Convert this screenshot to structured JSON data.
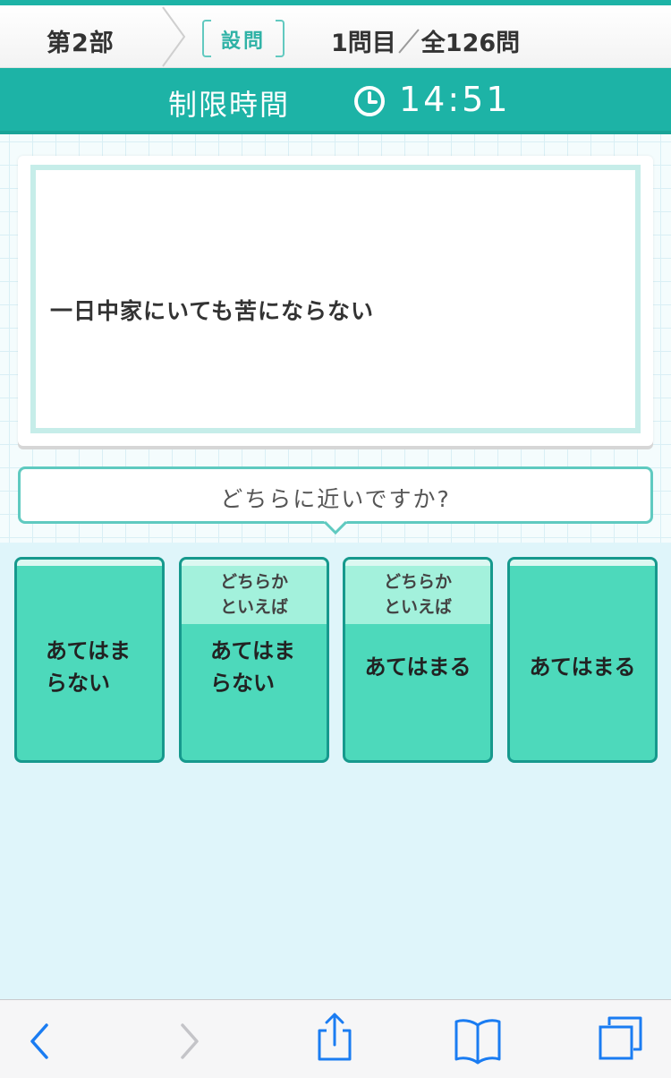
{
  "header": {
    "part": "第2部",
    "section_tag": "設問",
    "current": "1問目",
    "total": "全126問"
  },
  "timer": {
    "label": "制限時間",
    "value": "14:51"
  },
  "question": {
    "text": "一日中家にいても苦にならない"
  },
  "prompt": {
    "text": "どちらに近いですか?"
  },
  "answers": [
    {
      "qualifier": "",
      "label_line1": "あてはま",
      "label_line2": "らない"
    },
    {
      "qualifier_line1": "どちらか",
      "qualifier_line2": "といえば",
      "label_line1": "あてはま",
      "label_line2": "らない"
    },
    {
      "qualifier_line1": "どちらか",
      "qualifier_line2": "といえば",
      "label": "あてはまる"
    },
    {
      "qualifier": "",
      "label": "あてはまる"
    }
  ],
  "toolbar": {
    "icons": [
      "back-icon",
      "forward-icon",
      "share-icon",
      "bookmarks-icon",
      "tabs-icon"
    ]
  },
  "colors": {
    "teal": "#1db3a6",
    "answer_fill": "#4dd9bb",
    "answer_border": "#16998d",
    "qualifier_fill": "#a3f1dc",
    "ios_blue": "#1a7cf2"
  }
}
